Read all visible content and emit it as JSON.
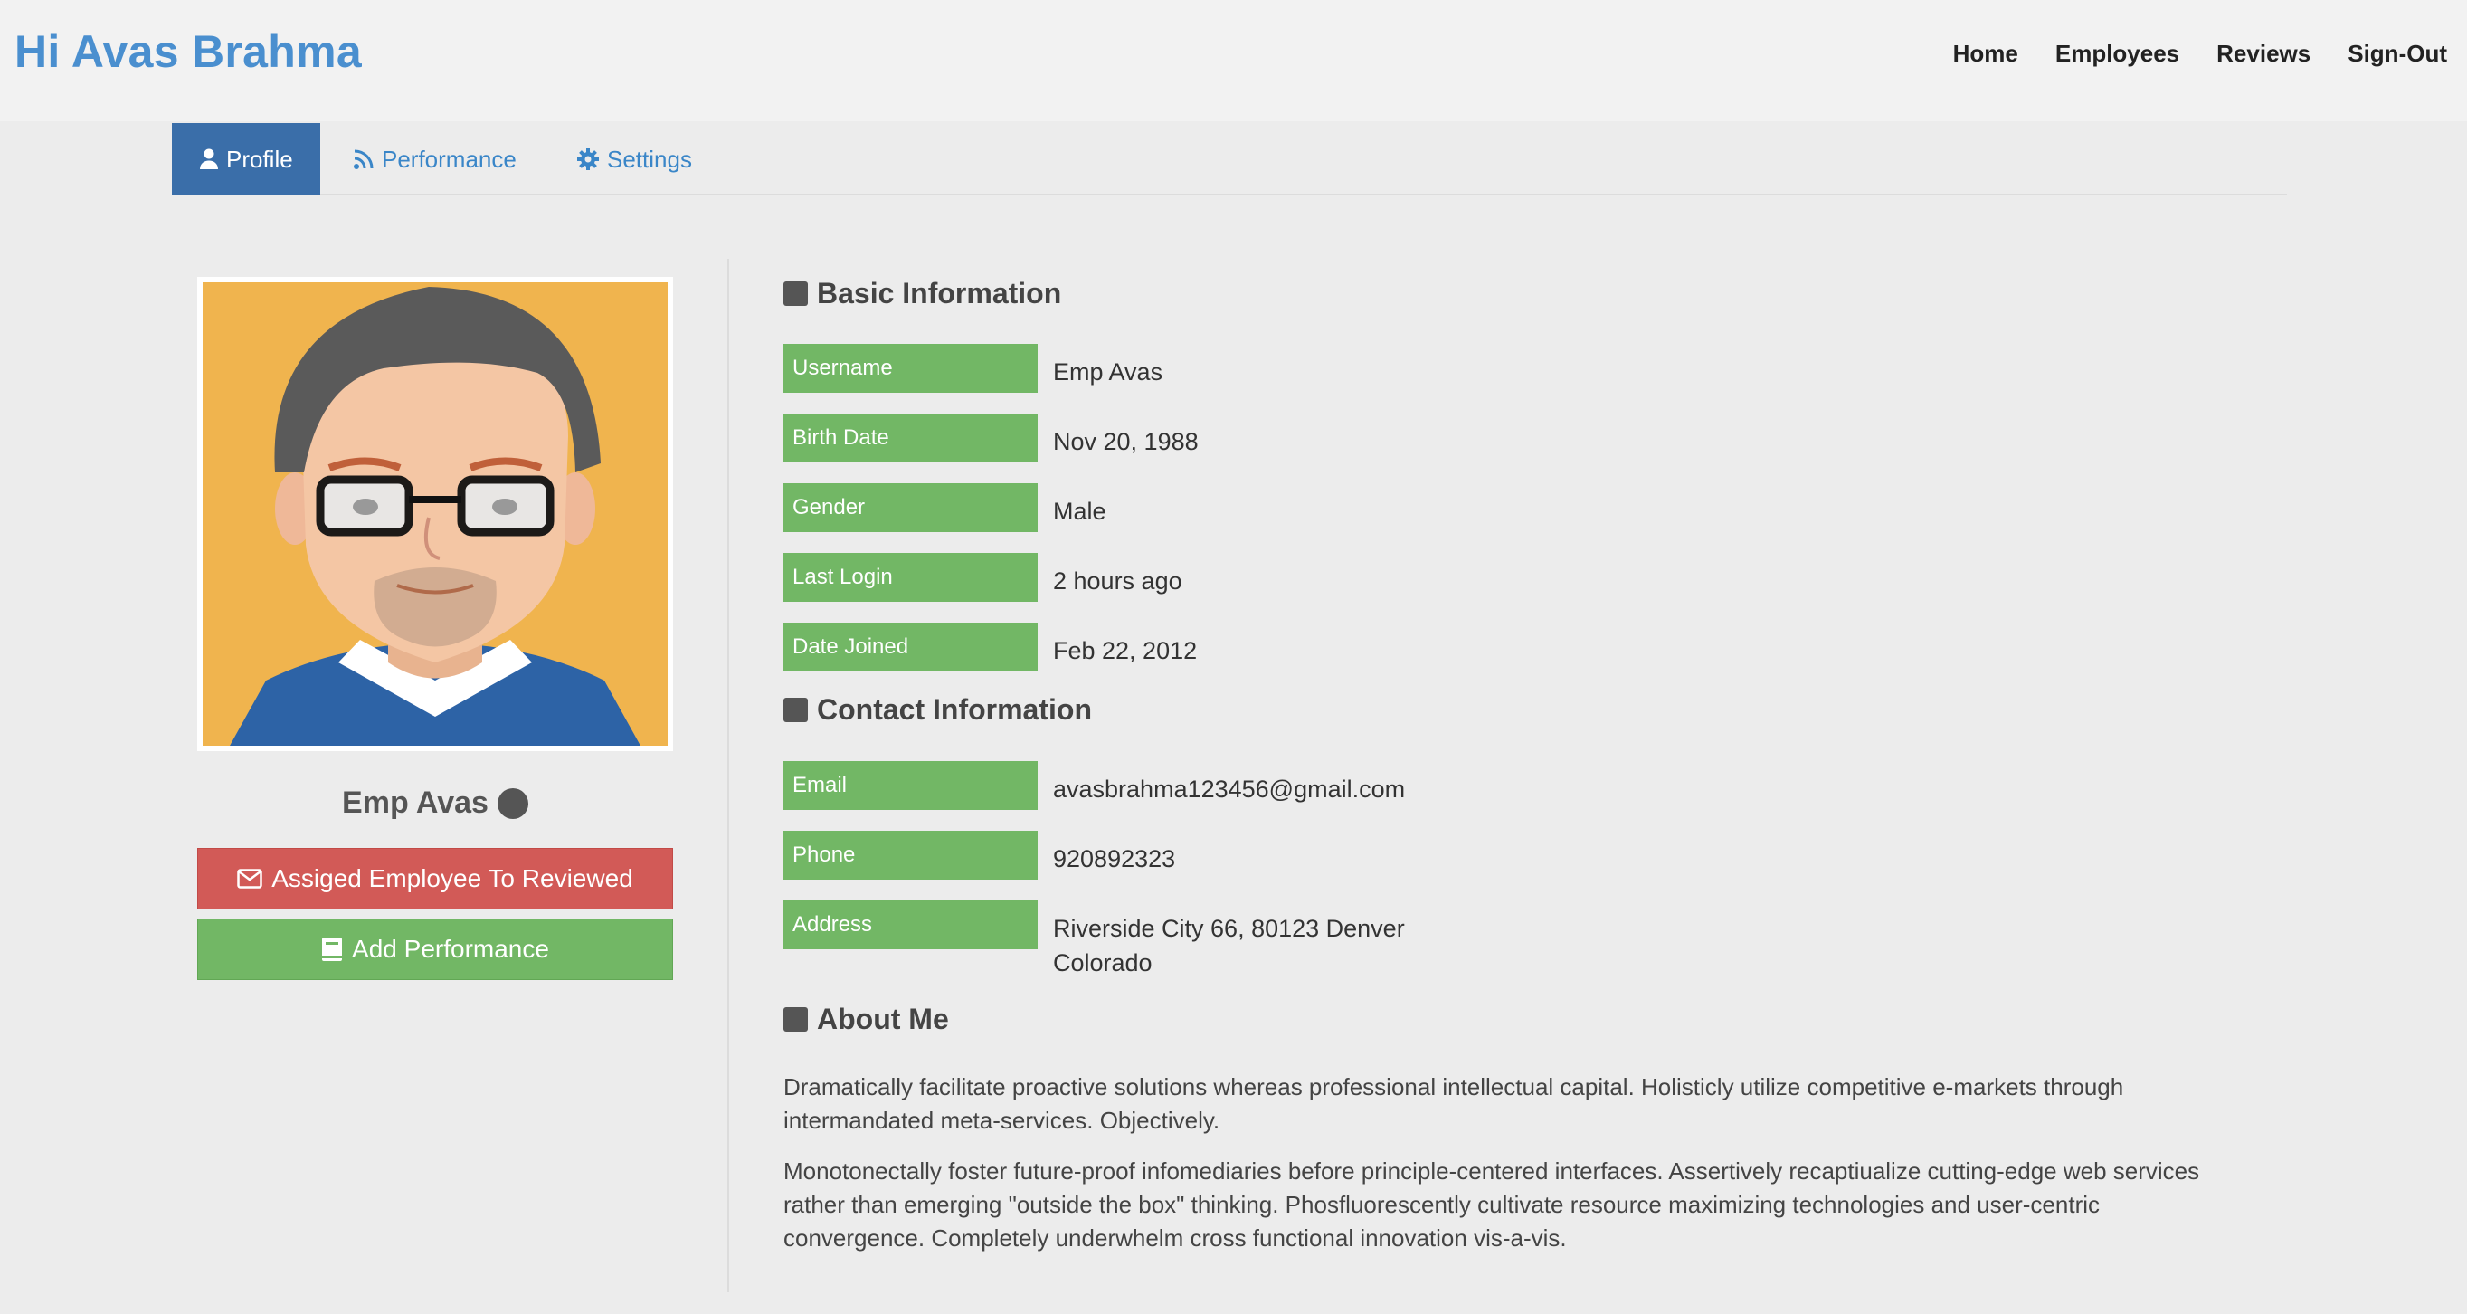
{
  "brand": "Hi Avas Brahma",
  "nav": [
    "Home",
    "Employees",
    "Reviews",
    "Sign-Out"
  ],
  "tabs": [
    {
      "label": "Profile",
      "icon": "user-icon",
      "active": true
    },
    {
      "label": "Performance",
      "icon": "rss-icon",
      "active": false
    },
    {
      "label": "Settings",
      "icon": "gear-icon",
      "active": false
    }
  ],
  "profile": {
    "name": "Emp Avas",
    "assign_button": "Assiged Employee To Reviewed",
    "add_button": "Add Performance"
  },
  "basic": {
    "title": "Basic Information",
    "rows": [
      {
        "label": "Username",
        "value": "Emp Avas"
      },
      {
        "label": "Birth Date",
        "value": "Nov 20, 1988"
      },
      {
        "label": "Gender",
        "value": "Male"
      },
      {
        "label": "Last Login",
        "value": "2 hours ago"
      },
      {
        "label": "Date Joined",
        "value": "Feb 22, 2012"
      }
    ]
  },
  "contact": {
    "title": "Contact Information",
    "rows": [
      {
        "label": "Email",
        "value": "avasbrahma123456@gmail.com"
      },
      {
        "label": "Phone",
        "value": "920892323"
      },
      {
        "label": "Address",
        "value": "Riverside City 66, 80123 Denver Colorado"
      }
    ]
  },
  "about": {
    "title": "About Me",
    "paragraphs": [
      "Dramatically facilitate proactive solutions whereas professional intellectual capital. Holisticly utilize competitive e-markets through intermandated meta-services. Objectively.",
      "Monotonectally foster future-proof infomediaries before principle-centered interfaces. Assertively recaptiualize cutting-edge web services rather than emerging \"outside the box\" thinking. Phosfluorescently cultivate resource maximizing technologies and user-centric convergence. Completely underwhelm cross functional innovation vis-a-vis."
    ]
  },
  "colors": {
    "brand": "#4a8fcf",
    "tab_active": "#3a6ea9",
    "label_green": "#72b765",
    "danger": "#d25a57"
  }
}
